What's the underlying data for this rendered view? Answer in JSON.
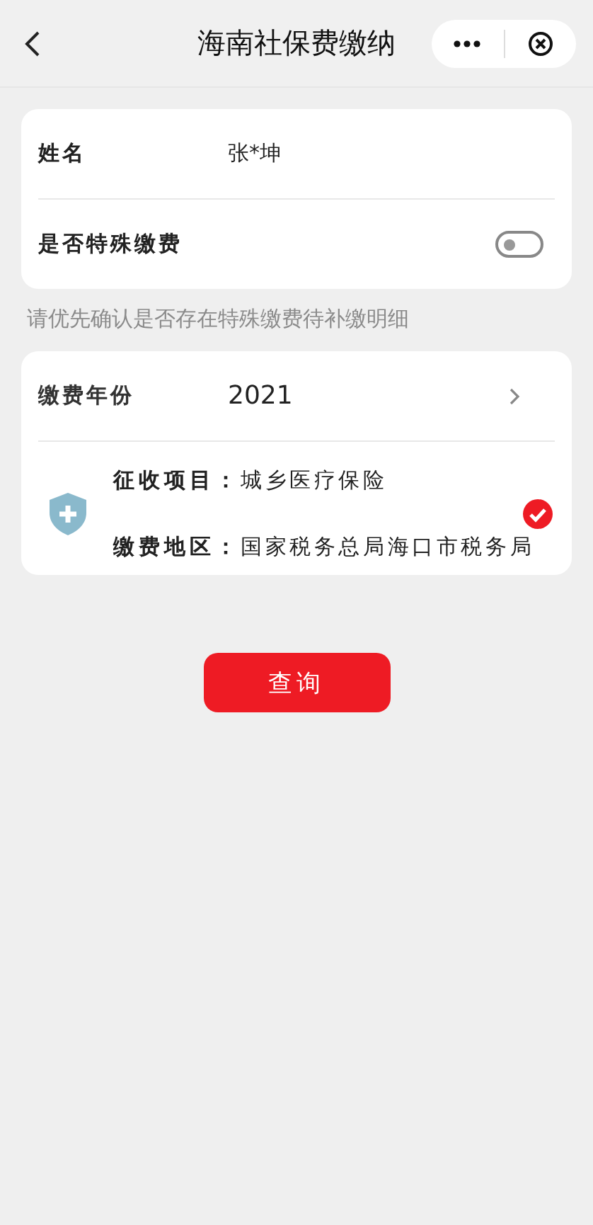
{
  "header": {
    "title": "海南社保费缴纳"
  },
  "personal_card": {
    "name_label": "姓名",
    "name_value": "张*坤",
    "special_label": "是否特殊缴费",
    "special_on": false
  },
  "hint": "请优先确认是否存在特殊缴费待补缴明细",
  "payment_card": {
    "year_label": "缴费年份",
    "year_value": "2021",
    "items": [
      {
        "project_label": "征收项目：",
        "project_value": "城乡医疗保险",
        "region_label": "缴费地区：",
        "region_value": "国家税务总局海口市税务局",
        "selected": true
      }
    ]
  },
  "query_button": "查询"
}
